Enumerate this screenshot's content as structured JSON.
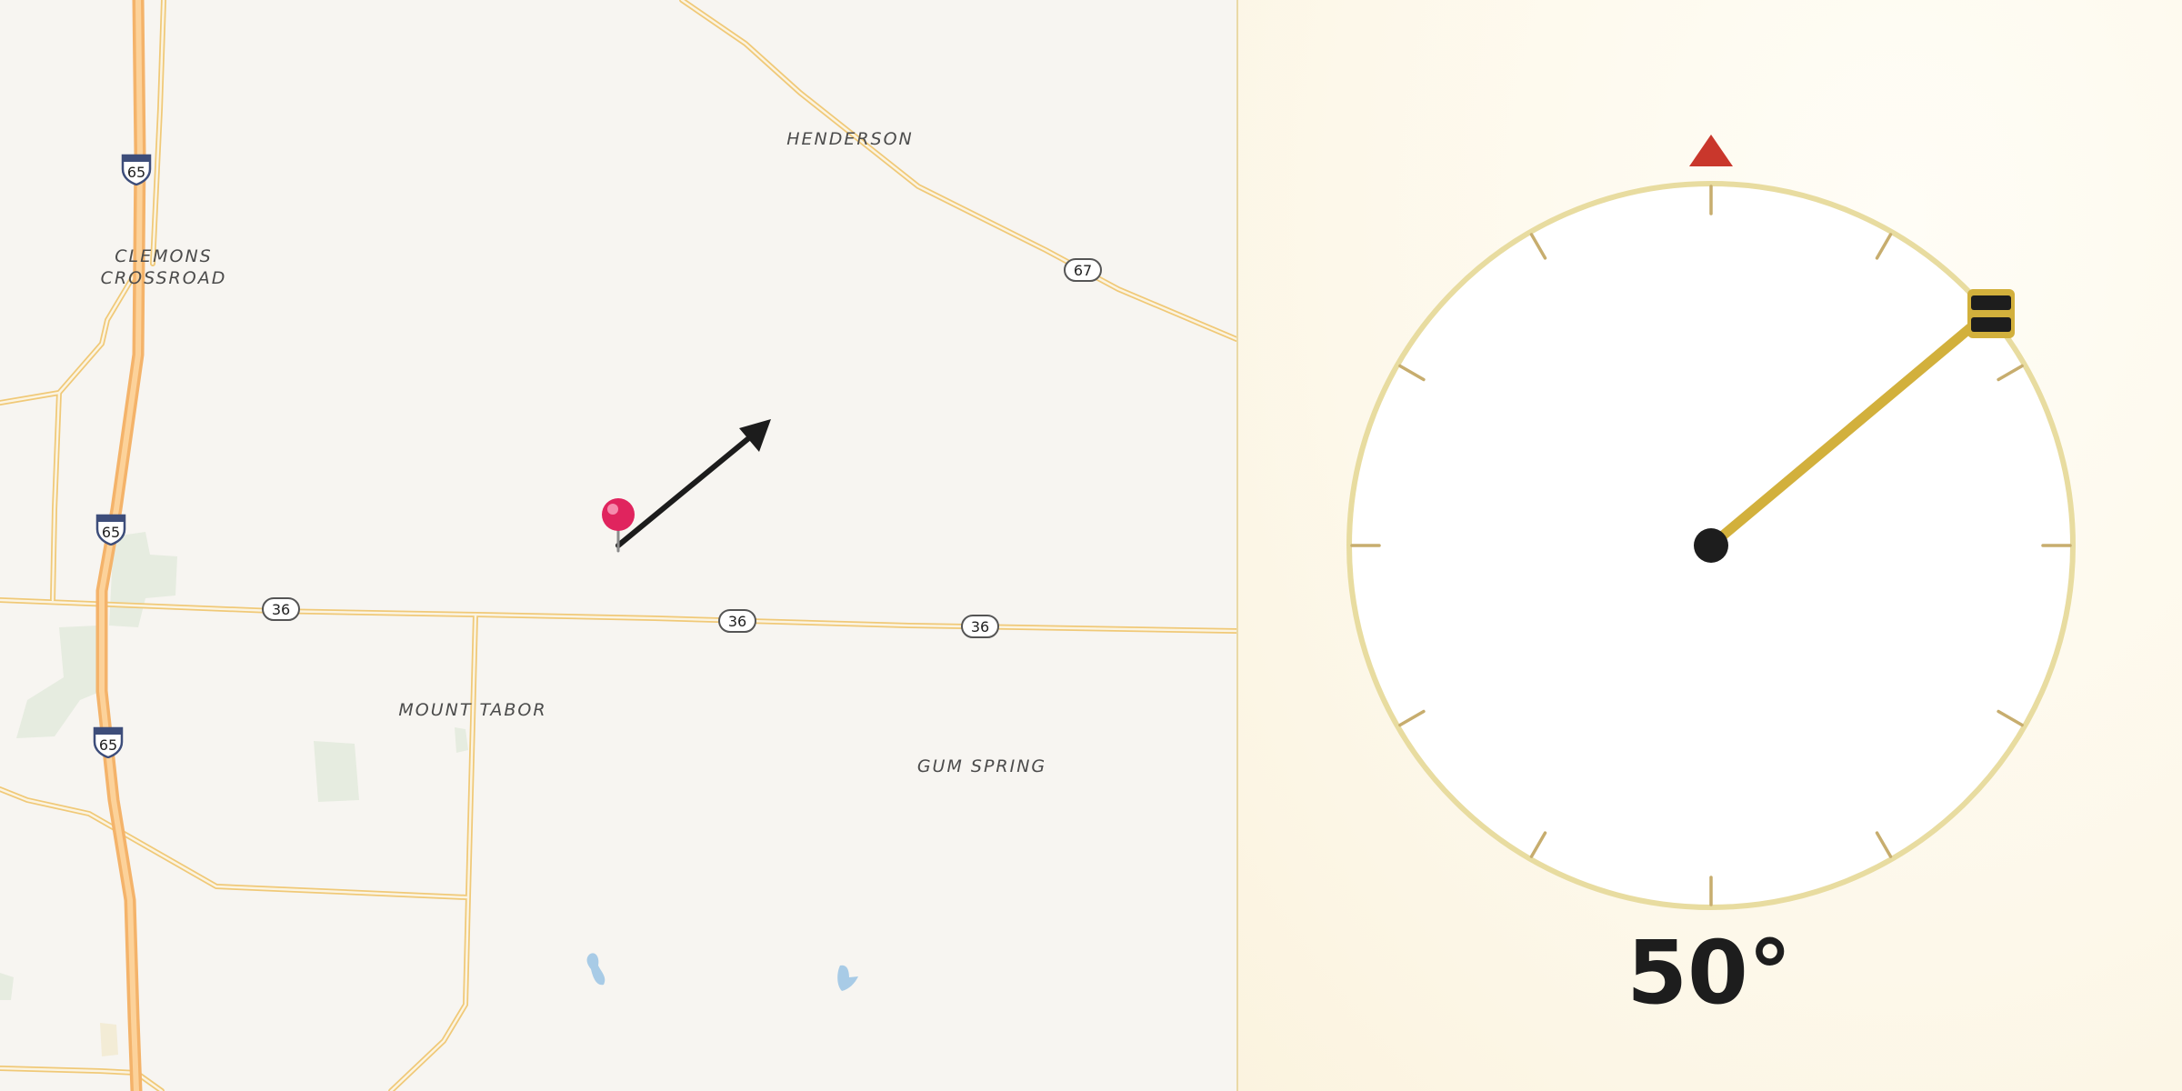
{
  "map": {
    "places": [
      {
        "id": "clemons",
        "line1": "CLEMONS",
        "line2": "CROSSROAD"
      },
      {
        "id": "henderson",
        "line1": "HENDERSON"
      },
      {
        "id": "mount-tabor",
        "line1": "MOUNT TABOR"
      },
      {
        "id": "gum-spring",
        "line1": "GUM SPRING"
      }
    ],
    "shields": {
      "interstate": "65",
      "route_36": "36",
      "route_67": "67"
    },
    "pin_color": "#e0245e",
    "arrow_icon": "direction-arrow-icon"
  },
  "compass": {
    "bearing_degrees": 50,
    "bearing_label": "50°",
    "north_marker_color": "#c9372c",
    "needle_color": "#d2b03c",
    "ring_color": "#e8dca0"
  }
}
